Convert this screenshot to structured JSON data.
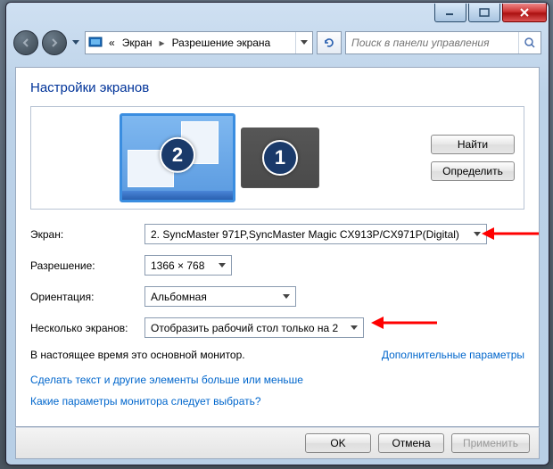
{
  "breadcrumb": {
    "chevrons": "«",
    "seg1": "Экран",
    "seg2": "Разрешение экрана"
  },
  "search": {
    "placeholder": "Поиск в панели управления"
  },
  "title": "Настройки экранов",
  "preview": {
    "detect": "Найти",
    "identify": "Определить",
    "mon1": "1",
    "mon2": "2"
  },
  "labels": {
    "display": "Экран:",
    "resolution": "Разрешение:",
    "orientation": "Ориентация:",
    "multi": "Несколько экранов:"
  },
  "values": {
    "display": "2. SyncMaster 971P,SyncMaster Magic CX913P/CX971P(Digital)",
    "resolution": "1366 × 768",
    "orientation": "Альбомная",
    "multi": "Отобразить рабочий стол только на 2"
  },
  "status": "В настоящее время это основной монитор.",
  "advanced": "Дополнительные параметры",
  "link1": "Сделать текст и другие элементы больше или меньше",
  "link2": "Какие параметры монитора следует выбрать?",
  "buttons": {
    "ok": "OK",
    "cancel": "Отмена",
    "apply": "Применить"
  }
}
